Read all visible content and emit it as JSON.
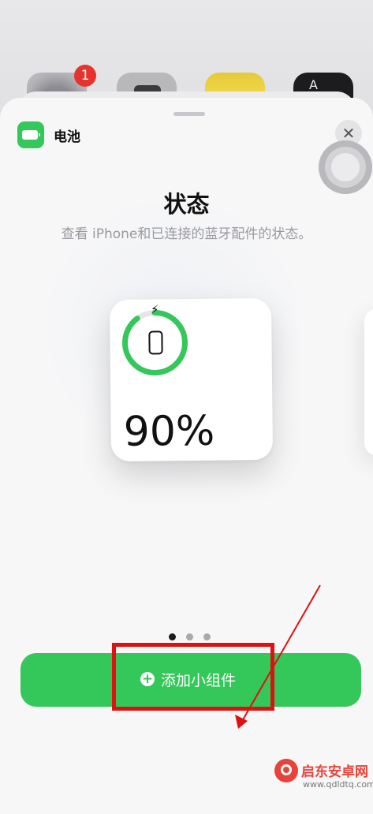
{
  "homescreen": {
    "settings_badge": "1",
    "dictionary_icon_letter": "A"
  },
  "sheet": {
    "app_name": "电池",
    "close_label": "✕",
    "title": "状态",
    "subtitle": "查看 iPhone和已连接的蓝牙配件的状态。"
  },
  "widget": {
    "battery_percent": "90%",
    "battery_level": 0.9,
    "charging": true,
    "bolt_icon": "⚡"
  },
  "pagination": {
    "count": 3,
    "current": 1
  },
  "add_button": {
    "plus": "+",
    "label": "添加小组件"
  },
  "watermark": {
    "name": "启东安卓网",
    "url": "www.qdldtq.com"
  },
  "colors": {
    "accent_green": "#34c759",
    "annotation_red": "#e01010",
    "ring_track": "#e5e5ea",
    "dot_active": "#1c1c1e",
    "dot_inactive": "#a9a9ad"
  }
}
